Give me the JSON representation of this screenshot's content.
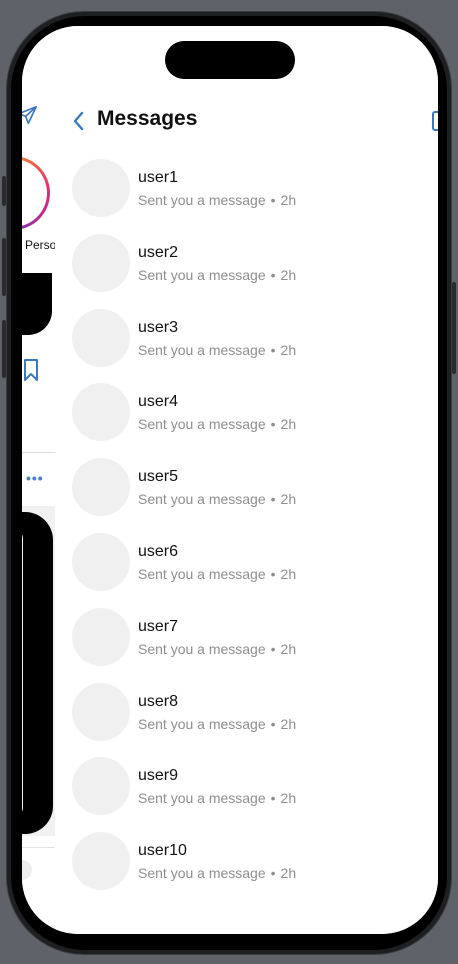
{
  "colors": {
    "accent": "#3a78c2",
    "background": "#ffffff",
    "avatar_placeholder": "#f0f0f0",
    "secondary_text": "#8e8e8e"
  },
  "underlying": {
    "story_label": "Perso",
    "icons": [
      "send-icon",
      "bookmark-icon",
      "more-icon"
    ]
  },
  "header": {
    "title": "Messages",
    "back_icon": "chevron-left-icon",
    "compose_icon": "compose-icon"
  },
  "conversations": [
    {
      "username": "user1",
      "preview": "Sent you a message",
      "separator": "•",
      "time": "2h"
    },
    {
      "username": "user2",
      "preview": "Sent you a message",
      "separator": "•",
      "time": "2h"
    },
    {
      "username": "user3",
      "preview": "Sent you a message",
      "separator": "•",
      "time": "2h"
    },
    {
      "username": "user4",
      "preview": "Sent you a message",
      "separator": "•",
      "time": "2h"
    },
    {
      "username": "user5",
      "preview": "Sent you a message",
      "separator": "•",
      "time": "2h"
    },
    {
      "username": "user6",
      "preview": "Sent you a message",
      "separator": "•",
      "time": "2h"
    },
    {
      "username": "user7",
      "preview": "Sent you a message",
      "separator": "•",
      "time": "2h"
    },
    {
      "username": "user8",
      "preview": "Sent you a message",
      "separator": "•",
      "time": "2h"
    },
    {
      "username": "user9",
      "preview": "Sent you a message",
      "separator": "•",
      "time": "2h"
    },
    {
      "username": "user10",
      "preview": "Sent you a message",
      "separator": "•",
      "time": "2h"
    }
  ]
}
